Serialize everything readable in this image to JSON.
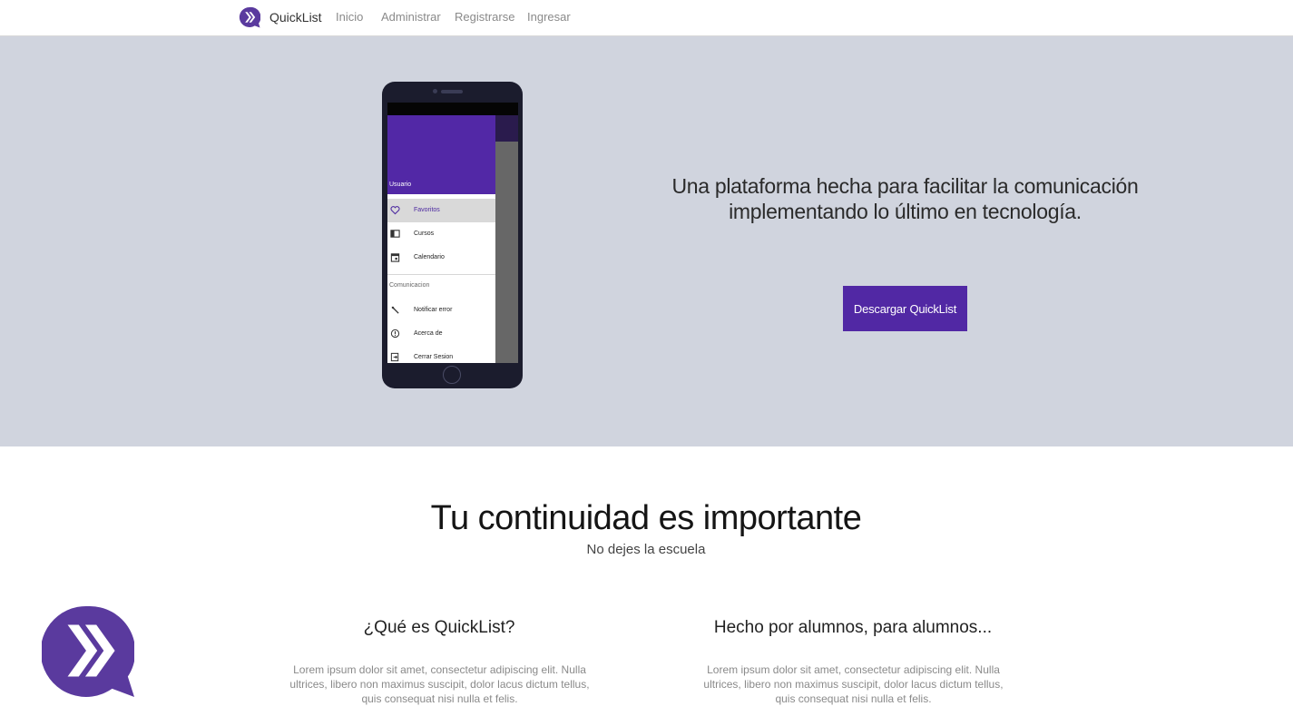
{
  "nav": {
    "brand": "QuickList",
    "links": [
      "Inicio",
      "Administrar",
      "Registrarse",
      "Ingresar"
    ]
  },
  "hero": {
    "tagline": "Una plataforma hecha para facilitar la comunicación implementando lo último en tecnología.",
    "download_button": "Descargar QuickList",
    "phone": {
      "user_label": "Usuario",
      "menu": [
        "Favoritos",
        "Cursos",
        "Calendario"
      ],
      "section_label": "Comunicacion",
      "menu2": [
        "Notificar error",
        "Acerca de",
        "Cerrar Sesion"
      ]
    }
  },
  "section": {
    "title": "Tu continuidad es importante",
    "subtitle": "No dejes la escuela"
  },
  "features": [
    {
      "title": "¿Qué es QuickList?",
      "text": "Lorem ipsum dolor sit amet, consectetur adipiscing elit. Nulla ultrices, libero non maximus suscipit, dolor lacus dictum tellus, quis consequat nisi nulla et felis."
    },
    {
      "title": "Hecho por alumnos, para alumnos...",
      "text": "Lorem ipsum dolor sit amet, consectetur adipiscing elit. Nulla ultrices, libero non maximus suscipit, dolor lacus dictum tellus, quis consequat nisi nulla et felis."
    }
  ],
  "colors": {
    "brand": "#5128a4",
    "hero_bg": "#d0d4de",
    "drawer_header": "#5228a6"
  }
}
